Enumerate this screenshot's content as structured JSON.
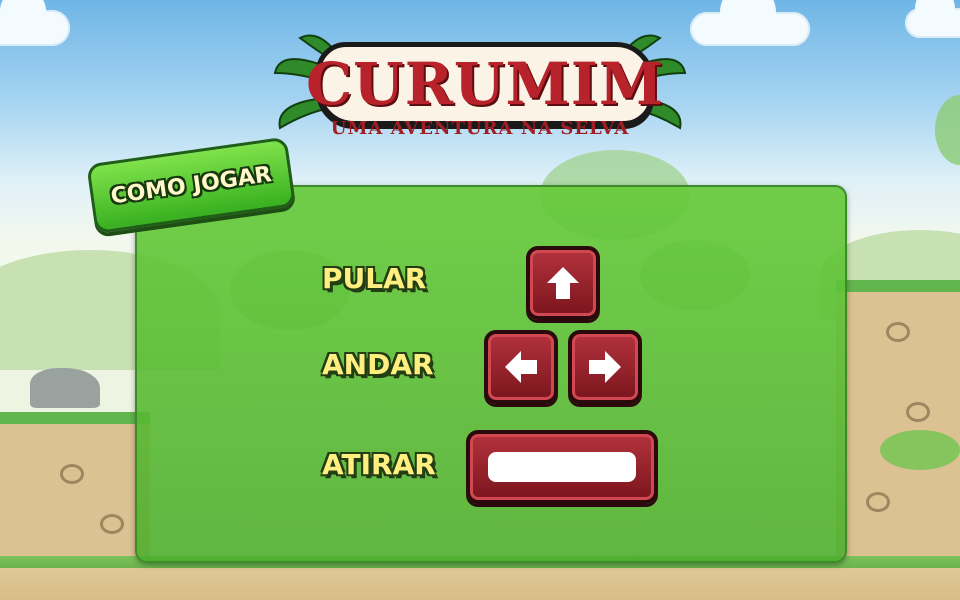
{
  "logo": {
    "title": "CURUMIM",
    "subtitle": "UMA AVENTURA NA SELVA"
  },
  "panel": {
    "tab_label": "COMO JOGAR",
    "controls": [
      {
        "label": "PULAR",
        "keys": [
          "arrow-up-icon"
        ]
      },
      {
        "label": "ANDAR",
        "keys": [
          "arrow-left-icon",
          "arrow-right-icon"
        ]
      },
      {
        "label": "ATIRAR",
        "keys": [
          "space-bar"
        ]
      }
    ]
  },
  "colors": {
    "panel_green": "#5cc637",
    "key_red": "#9b222b",
    "label_yellow": "#ffef80",
    "logo_red": "#b8222a"
  }
}
